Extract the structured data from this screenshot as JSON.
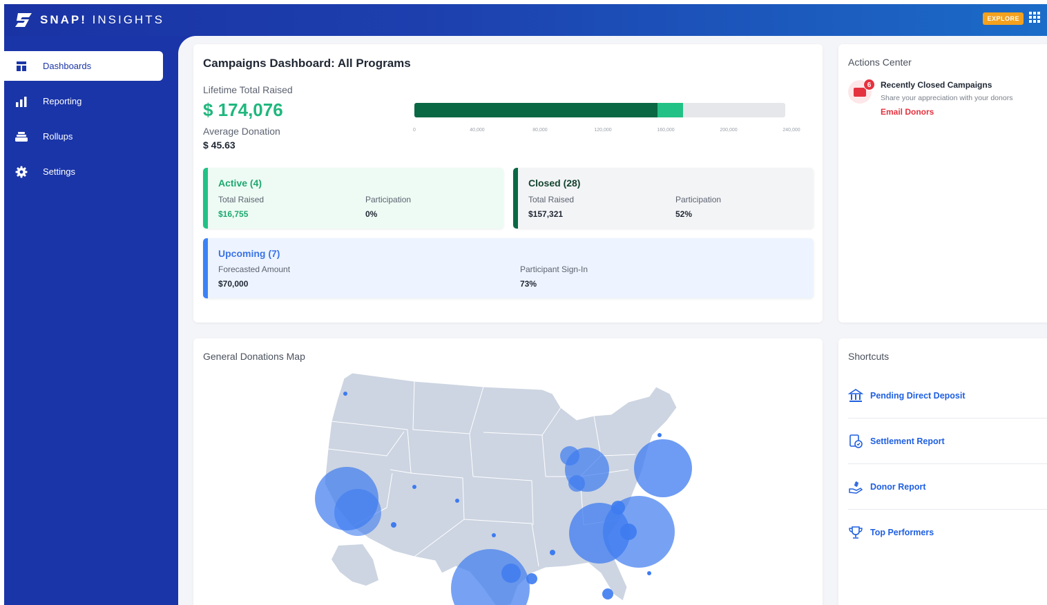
{
  "brand": {
    "name_bold": "SNAP!",
    "name_rest": " INSIGHTS"
  },
  "topbar": {
    "explore_label": "EXPLORE"
  },
  "sidebar": {
    "items": [
      {
        "label": "Dashboards",
        "icon": "dashboard-icon",
        "active": true
      },
      {
        "label": "Reporting",
        "icon": "bar-chart-icon",
        "active": false
      },
      {
        "label": "Rollups",
        "icon": "stack-icon",
        "active": false
      },
      {
        "label": "Settings",
        "icon": "gear-icon",
        "active": false
      }
    ]
  },
  "summary": {
    "title": "Campaigns Dashboard: All Programs",
    "lifetime_label": "Lifetime Total Raised",
    "lifetime_value": "$ 174,076",
    "average_label": "Average Donation",
    "average_value": "$ 45.63",
    "bar": {
      "closed_value": 157321,
      "active_value": 16755,
      "max": 240000,
      "ticks": [
        "0",
        "40,000",
        "80,000",
        "120,000",
        "160,000",
        "200,000",
        "240,000"
      ],
      "colors": {
        "closed": "#0a6845",
        "active": "#22c185",
        "track": "#e6e7ea"
      }
    },
    "active": {
      "title": "Active (4)",
      "raised_label": "Total Raised",
      "raised_value": "$16,755",
      "participation_label": "Participation",
      "participation_value": "0%",
      "accent": "#22c185"
    },
    "closed": {
      "title": "Closed (28)",
      "raised_label": "Total Raised",
      "raised_value": "$157,321",
      "participation_label": "Participation",
      "participation_value": "52%",
      "accent": "#0a6845"
    },
    "upcoming": {
      "title": "Upcoming (7)",
      "forecast_label": "Forecasted Amount",
      "forecast_value": "$70,000",
      "signin_label": "Participant Sign-In",
      "signin_value": "73%",
      "accent": "#3b82f6"
    }
  },
  "actions": {
    "heading": "Actions Center",
    "badge_count": "6",
    "item_title": "Recently Closed Campaigns",
    "item_subtitle": "Share your appreciation with your donors",
    "item_link": "Email Donors"
  },
  "map": {
    "heading": "General Donations Map",
    "bubble_color": "#3d7bf0"
  },
  "shortcuts": {
    "heading": "Shortcuts",
    "items": [
      {
        "label": "Pending Direct Deposit",
        "icon": "bank-icon"
      },
      {
        "label": "Settlement Report",
        "icon": "receipt-icon"
      },
      {
        "label": "Donor Report",
        "icon": "donation-hand-icon"
      },
      {
        "label": "Top Performers",
        "icon": "trophy-icon"
      }
    ]
  }
}
